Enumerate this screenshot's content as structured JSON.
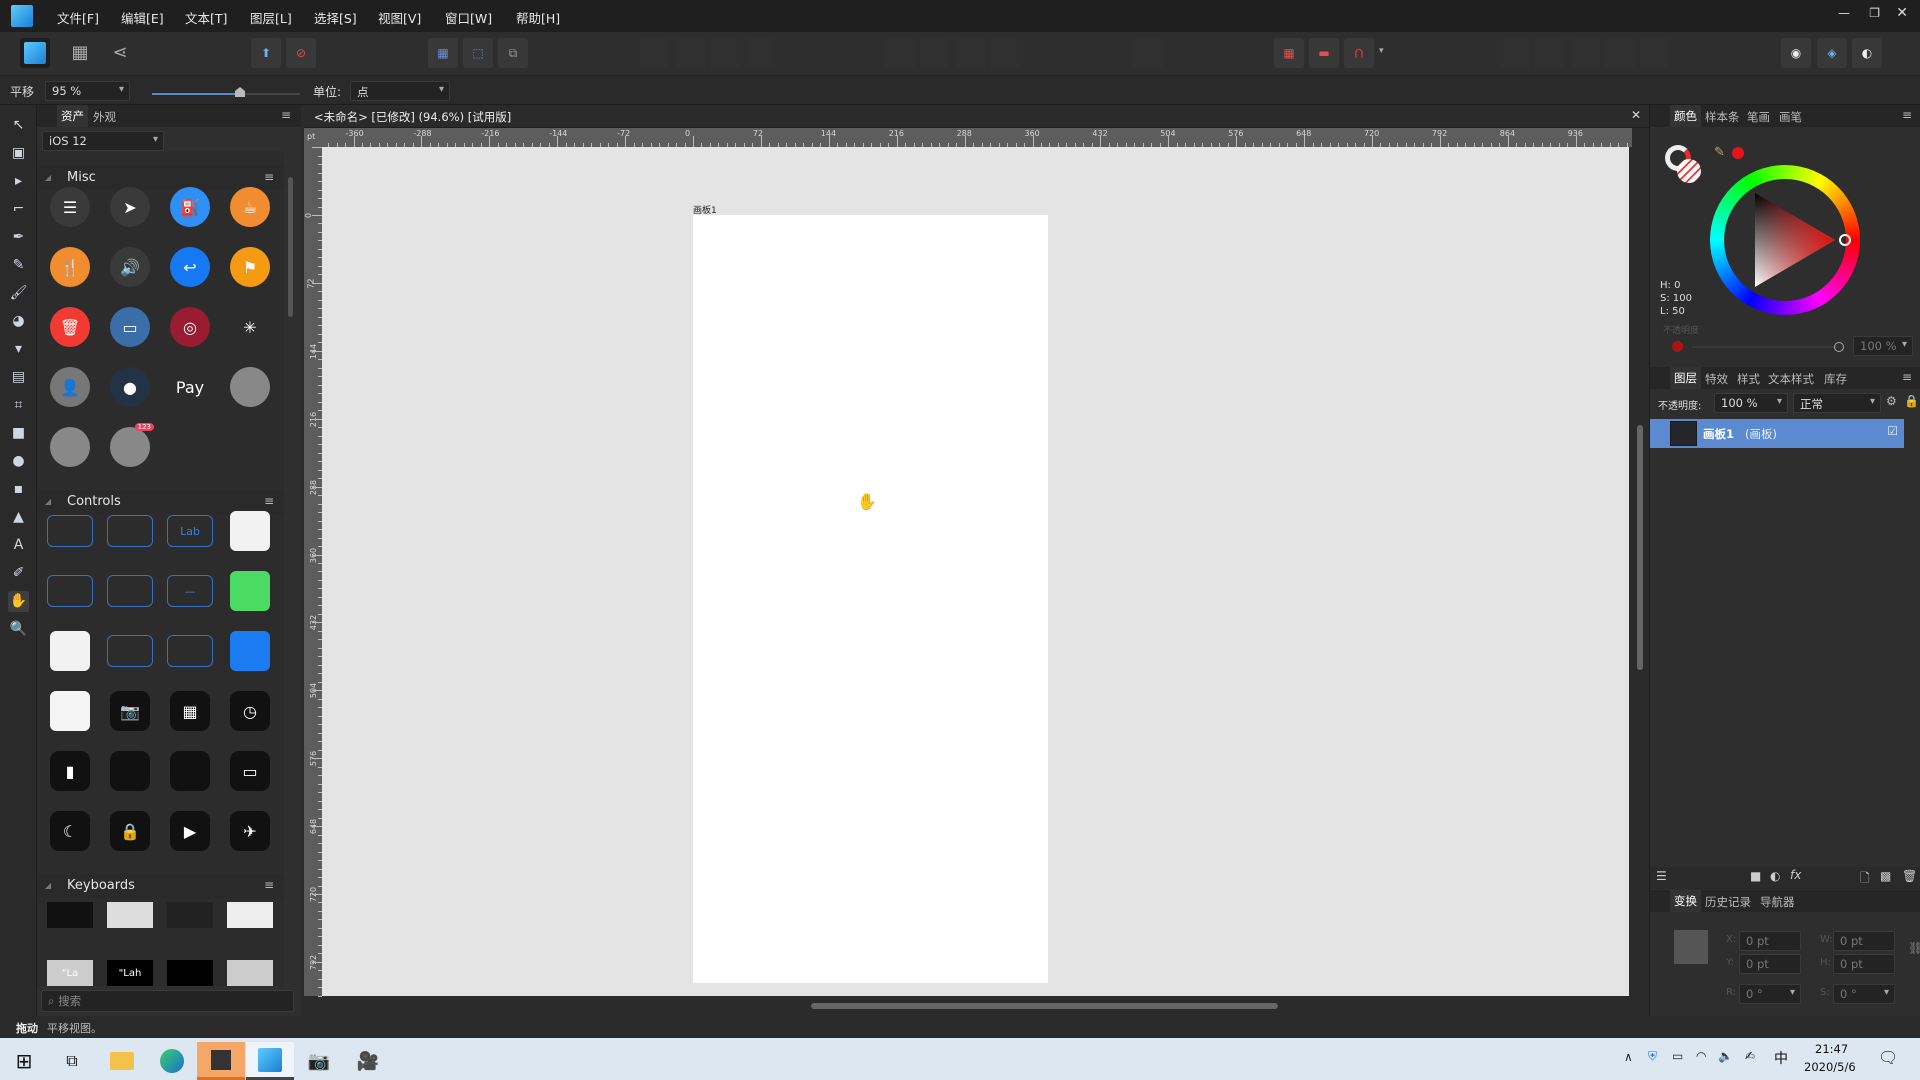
{
  "menu": [
    "文件[F]",
    "编辑[E]",
    "文本[T]",
    "图层[L]",
    "选择[S]",
    "视图[V]",
    "窗口[W]",
    "帮助[H]"
  ],
  "context": {
    "tool_name": "平移",
    "zoom": "95 %",
    "unit_label": "单位:",
    "unit_value": "点"
  },
  "assets": {
    "tabs": [
      "资产",
      "外观"
    ],
    "set": "iOS 12",
    "search_placeholder": "搜索",
    "sections": [
      {
        "title": "Misc"
      },
      {
        "title": "Controls"
      },
      {
        "title": "Keyboards"
      }
    ],
    "misc": [
      {
        "icon": "list-icon",
        "color": "#3a3a3a",
        "glyph": "☰"
      },
      {
        "icon": "location-arrow-icon",
        "color": "#3a3a3a",
        "glyph": "➤"
      },
      {
        "icon": "fuel-icon",
        "color": "#2f8ff5",
        "glyph": "⛽"
      },
      {
        "icon": "coffee-cup-icon",
        "color": "#f18d30",
        "glyph": "☕"
      },
      {
        "icon": "fork-knife-icon",
        "color": "#f18d30",
        "glyph": "🍴"
      },
      {
        "icon": "speaker-icon",
        "color": "#3a3a3a",
        "glyph": "🔊"
      },
      {
        "icon": "reply-icon",
        "color": "#1479f2",
        "glyph": "↩"
      },
      {
        "icon": "flag-icon",
        "color": "#f59a13",
        "glyph": "⚑"
      },
      {
        "icon": "trash-icon",
        "color": "#f03a32",
        "glyph": "🗑"
      },
      {
        "icon": "archive-box-icon",
        "color": "#3a6ea8",
        "glyph": "▭"
      },
      {
        "icon": "fingerprint-icon",
        "color": "#9a1c32",
        "glyph": "◎"
      },
      {
        "icon": "spinner-icon",
        "color": "transparent",
        "glyph": "✳"
      },
      {
        "icon": "avatar-icon",
        "color": "#777",
        "glyph": "👤"
      },
      {
        "icon": "radio-dot-icon",
        "color": "#233244",
        "glyph": "●"
      },
      {
        "icon": "apple-pay-icon",
        "color": "transparent",
        "glyph": "Pay"
      },
      {
        "icon": "avatar-placeholder-icon",
        "color": "#888",
        "glyph": ""
      },
      {
        "icon": "avatar-placeholder-icon",
        "color": "#888",
        "glyph": ""
      },
      {
        "icon": "avatar-badge-icon",
        "color": "#888",
        "glyph": ""
      }
    ],
    "misc_badge": "123",
    "controls": [
      {
        "icon": "text-field-icon",
        "color": "transparent",
        "glyph": ""
      },
      {
        "icon": "text-field-icon",
        "color": "transparent",
        "glyph": ""
      },
      {
        "icon": "label-field-icon",
        "color": "transparent",
        "glyph": "Lab"
      },
      {
        "icon": "white-button-icon",
        "color": "#f2f2f2",
        "glyph": ""
      },
      {
        "icon": "text-field-icon",
        "color": "transparent",
        "glyph": ""
      },
      {
        "icon": "text-field-icon",
        "color": "transparent",
        "glyph": ""
      },
      {
        "icon": "stepper-field-icon",
        "color": "transparent",
        "glyph": "—"
      },
      {
        "icon": "toggle-on-icon",
        "color": "#4cd964",
        "glyph": ""
      },
      {
        "icon": "toggle-off-icon",
        "color": "#f2f2f2",
        "glyph": ""
      },
      {
        "icon": "slider-line-icon",
        "color": "transparent",
        "glyph": ""
      },
      {
        "icon": "slider-line-icon",
        "color": "transparent",
        "glyph": ""
      },
      {
        "icon": "blue-button-icon",
        "color": "#1a7cf0",
        "glyph": ""
      },
      {
        "icon": "picker-icon",
        "color": "#f5f5f5",
        "glyph": ""
      },
      {
        "icon": "camera-icon",
        "color": "#111",
        "glyph": "📷"
      },
      {
        "icon": "calculator-icon",
        "color": "#111",
        "glyph": "▦"
      },
      {
        "icon": "timer-icon",
        "color": "#111",
        "glyph": "◷"
      },
      {
        "icon": "flashlight-icon",
        "color": "#111",
        "glyph": "▮"
      },
      {
        "icon": "volume-slider-icon",
        "color": "#111",
        "glyph": ""
      },
      {
        "icon": "brightness-slider-icon",
        "color": "#111",
        "glyph": ""
      },
      {
        "icon": "screen-mirroring-icon",
        "color": "#111",
        "glyph": "▭"
      },
      {
        "icon": "moon-icon",
        "color": "#111",
        "glyph": "☾"
      },
      {
        "icon": "rotation-lock-icon",
        "color": "#111",
        "glyph": "🔒"
      },
      {
        "icon": "music-player-icon",
        "color": "#111",
        "glyph": "▶"
      },
      {
        "icon": "connectivity-icon",
        "color": "#111",
        "glyph": "✈"
      }
    ],
    "keyboards": [
      {
        "icon": "keyboard-dark-icon",
        "color": "#111",
        "glyph": ""
      },
      {
        "icon": "keyboard-light-icon",
        "color": "#ddd",
        "glyph": ""
      },
      {
        "icon": "numpad-dark-icon",
        "color": "#222",
        "glyph": ""
      },
      {
        "icon": "numpad-light-icon",
        "color": "#eee",
        "glyph": ""
      },
      {
        "icon": "label-light-icon",
        "color": "#ccc",
        "glyph": "\"La"
      },
      {
        "icon": "label-dark-icon",
        "color": "#000",
        "glyph": "\"Lah"
      },
      {
        "icon": "dark-block-icon",
        "color": "#000",
        "glyph": ""
      },
      {
        "icon": "light-block-icon",
        "color": "#ccc",
        "glyph": ""
      }
    ]
  },
  "document": {
    "title": "<未命名> [已修改] (94.6%) [试用版]",
    "artboard_label": "画板1",
    "ruler_unit": "pt",
    "h_ruler_labels": [
      "-360",
      "-288",
      "-216",
      "-144",
      "-72",
      "0",
      "72",
      "144",
      "216",
      "288",
      "360",
      "432",
      "504",
      "576",
      "648",
      "720",
      "792",
      "864",
      "936"
    ],
    "v_ruler_labels": [
      "0",
      "72",
      "144",
      "216",
      "288",
      "360",
      "432",
      "504",
      "576",
      "648",
      "720",
      "792"
    ]
  },
  "color_panel": {
    "tabs": [
      "颜色",
      "样本条",
      "笔画",
      "画笔"
    ],
    "h": "H: 0",
    "s": "S: 100",
    "l": "L: 50",
    "opacity_label": "不透明度",
    "opacity": "100 %",
    "current_color": "#e8141b"
  },
  "layers_panel": {
    "tabs": [
      "图层",
      "特效",
      "样式",
      "文本样式",
      "库存"
    ],
    "opacity_label": "不透明度:",
    "opacity": "100 %",
    "blend": "正常",
    "layers": [
      {
        "name": "画板1",
        "type": "(画板)",
        "visible": true
      }
    ]
  },
  "transform_panel": {
    "tabs": [
      "变换",
      "历史记录",
      "导航器"
    ],
    "x_label": "X:",
    "x": "0 pt",
    "y_label": "Y:",
    "y": "0 pt",
    "w_label": "W:",
    "w": "0 pt",
    "h_label": "H:",
    "h": "0 pt",
    "r_label": "R:",
    "r": "0 °",
    "s_label": "S:",
    "s": "0 °"
  },
  "status": {
    "bold": "拖动",
    "text": "平移视图。"
  },
  "taskbar": {
    "time": "21:47",
    "date": "2020/5/6",
    "ime": "中"
  }
}
